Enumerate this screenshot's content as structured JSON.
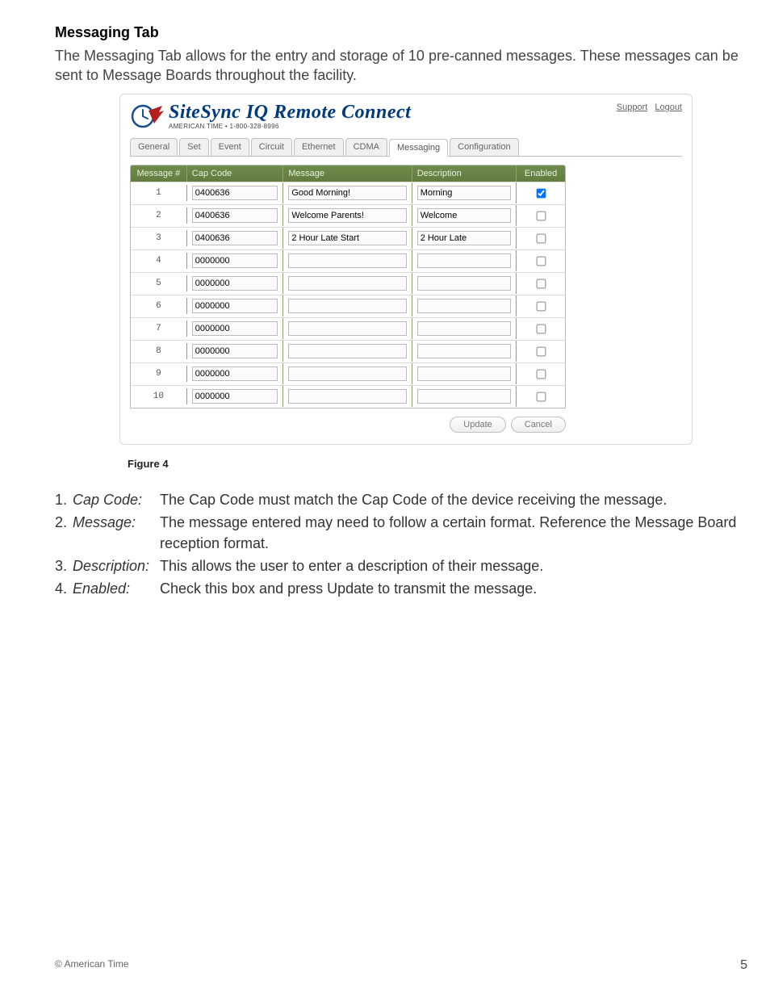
{
  "title": "Messaging Tab",
  "intro": "The Messaging Tab allows for the entry and storage of 10 pre-canned messages. These messages can be sent to Message Boards throughout the facility.",
  "screenshot": {
    "product_name": "SiteSync IQ Remote Connect",
    "company_line": "AMERICAN TIME • 1-800-328-8996",
    "links": {
      "support": "Support",
      "logout": "Logout"
    },
    "tabs": [
      "General",
      "Set",
      "Event",
      "Circuit",
      "Ethernet",
      "CDMA",
      "Messaging",
      "Configuration"
    ],
    "active_tab": "Messaging",
    "table": {
      "headers": {
        "num": "Message #",
        "cap": "Cap Code",
        "msg": "Message",
        "desc": "Description",
        "en": "Enabled"
      },
      "rows": [
        {
          "num": "1",
          "cap": "0400636",
          "msg": "Good Morning!",
          "desc": "Morning",
          "enabled": true
        },
        {
          "num": "2",
          "cap": "0400636",
          "msg": "Welcome Parents!",
          "desc": "Welcome",
          "enabled": false
        },
        {
          "num": "3",
          "cap": "0400636",
          "msg": "2 Hour Late Start",
          "desc": "2 Hour Late",
          "enabled": false
        },
        {
          "num": "4",
          "cap": "0000000",
          "msg": "",
          "desc": "",
          "enabled": false
        },
        {
          "num": "5",
          "cap": "0000000",
          "msg": "",
          "desc": "",
          "enabled": false
        },
        {
          "num": "6",
          "cap": "0000000",
          "msg": "",
          "desc": "",
          "enabled": false
        },
        {
          "num": "7",
          "cap": "0000000",
          "msg": "",
          "desc": "",
          "enabled": false
        },
        {
          "num": "8",
          "cap": "0000000",
          "msg": "",
          "desc": "",
          "enabled": false
        },
        {
          "num": "9",
          "cap": "0000000",
          "msg": "",
          "desc": "",
          "enabled": false
        },
        {
          "num": "10",
          "cap": "0000000",
          "msg": "",
          "desc": "",
          "enabled": false
        }
      ]
    },
    "buttons": {
      "update": "Update",
      "cancel": "Cancel"
    }
  },
  "figure_label": "Figure 4",
  "definitions": [
    {
      "num": "1.",
      "term": "Cap Code:",
      "desc": "The Cap Code must match the Cap Code of the device receiving the message."
    },
    {
      "num": "2.",
      "term": "Message:",
      "desc": "The message entered may need to follow a certain format. Reference the Message Board reception format."
    },
    {
      "num": "3.",
      "term": "Description:",
      "desc": "This allows the user to enter a description of their message."
    },
    {
      "num": "4.",
      "term": "Enabled:",
      "desc": "Check this box and press Update to transmit the message."
    }
  ],
  "footer": {
    "copyright": "© American Time",
    "page": "5"
  }
}
